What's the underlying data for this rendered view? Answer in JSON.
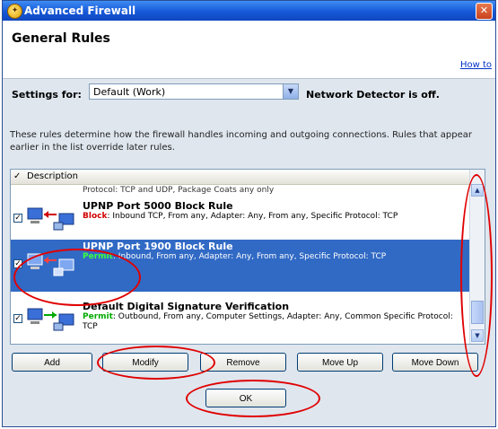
{
  "window": {
    "title": "Advanced Firewall",
    "close_glyph": "✕"
  },
  "header": {
    "title": "General Rules",
    "help_link": "How to"
  },
  "settings": {
    "label": "Settings for:",
    "value": "Default (Work)",
    "network_detector": "Network Detector is off."
  },
  "description": "These rules determine how the firewall handles incoming and outgoing connections. Rules that appear earlier in the list override later rules.",
  "list": {
    "column_header": "Description",
    "partial_row": "Protocol: TCP and UDP, Package Coats any only",
    "rows": [
      {
        "name": "UPNP Port 5000 Block Rule",
        "action": "Block",
        "action_type": "block",
        "detail": ": Inbound TCP, From any, Adapter: Any, From any, Specific Protocol: TCP",
        "checked": true,
        "selected": false
      },
      {
        "name": "UPNP Port 1900 Block Rule",
        "action": "Permit",
        "action_type": "permit",
        "detail": ": Inbound, From any, Adapter: Any, From any, Specific Protocol: TCP",
        "checked": true,
        "selected": true
      },
      {
        "name": "Default Digital Signature Verification",
        "action": "Permit",
        "action_type": "permit",
        "detail": ": Outbound, From any, Computer Settings, Adapter: Any, Common Specific Protocol: TCP",
        "checked": true,
        "selected": false
      }
    ]
  },
  "buttons": {
    "add": "Add",
    "modify": "Modify",
    "remove": "Remove",
    "move_up": "Move Up",
    "move_down": "Move Down",
    "ok": "OK"
  },
  "icons": {
    "title_icon": "firewall-shield-icon",
    "rule_icon": "computer-network-rule-icon"
  },
  "colors": {
    "selection": "#316ac5",
    "block": "#d00000",
    "permit": "#00aa00",
    "annotation": "#e00000"
  }
}
